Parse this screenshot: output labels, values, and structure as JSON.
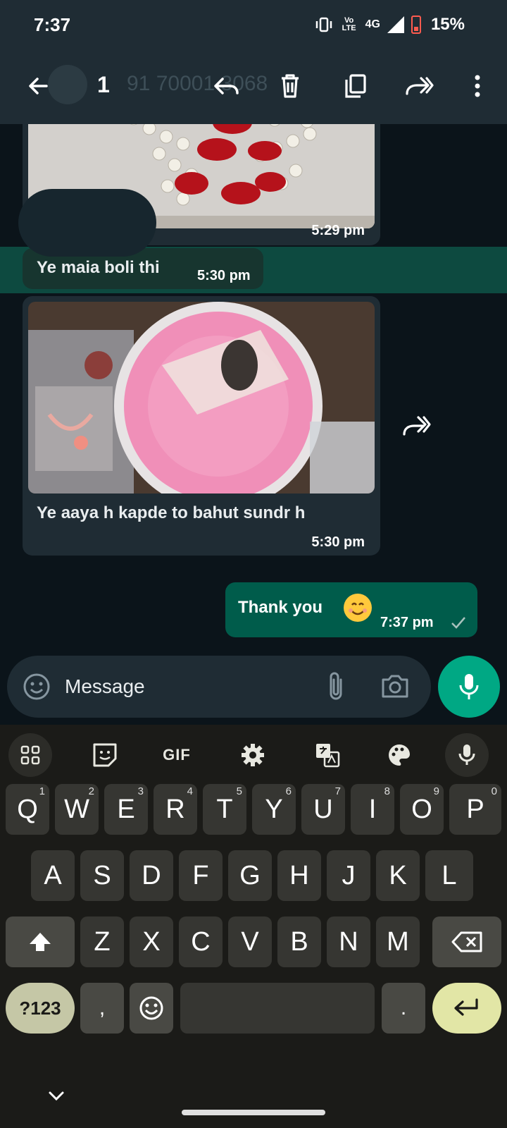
{
  "status_bar": {
    "time": "7:37",
    "network_volte": "Vo LTE",
    "network_type": "4G",
    "battery_percent": "15%",
    "battery_color": "#ff5b4f"
  },
  "app_bar": {
    "selected_count": "1",
    "background_number": "91 70001 3068",
    "icons": [
      "back-arrow-icon",
      "reply-icon",
      "delete-icon",
      "copy-icon",
      "forward-icon",
      "more-vert-icon"
    ]
  },
  "chat": {
    "messages": [
      {
        "type": "image",
        "direction": "incoming",
        "subject": "red and white pearl necklace",
        "time": "5:29 pm"
      },
      {
        "type": "text",
        "direction": "incoming",
        "text": "Ye maia boli thi",
        "time": "5:30 pm",
        "selected": true
      },
      {
        "type": "image",
        "direction": "incoming",
        "subject": "pink dress and jewelry set",
        "caption": "Ye aaya h kapde to bahut sundr h",
        "time": "5:30 pm"
      },
      {
        "type": "text",
        "direction": "outgoing",
        "text": "Thank you",
        "emoji": "smiling-face",
        "time": "7:37 pm",
        "status": "sent-tick"
      }
    ],
    "accent_outgoing": "#005c4b",
    "accent_selection": "#0d4a40"
  },
  "composer": {
    "placeholder": "Message",
    "icons": [
      "emoji-icon",
      "attach-icon",
      "camera-icon",
      "mic-icon"
    ],
    "send_button_color": "#00a884"
  },
  "keyboard": {
    "toolbar": [
      "apps-grid-icon",
      "sticker-icon",
      "GIF",
      "settings-icon",
      "translate-icon",
      "palette-icon",
      "mic-icon"
    ],
    "gif_label": "GIF",
    "row1": [
      {
        "k": "Q",
        "n": "1"
      },
      {
        "k": "W",
        "n": "2"
      },
      {
        "k": "E",
        "n": "3"
      },
      {
        "k": "R",
        "n": "4"
      },
      {
        "k": "T",
        "n": "5"
      },
      {
        "k": "Y",
        "n": "6"
      },
      {
        "k": "U",
        "n": "7"
      },
      {
        "k": "I",
        "n": "8"
      },
      {
        "k": "O",
        "n": "9"
      },
      {
        "k": "P",
        "n": "0"
      }
    ],
    "row2": [
      "A",
      "S",
      "D",
      "F",
      "G",
      "H",
      "J",
      "K",
      "L"
    ],
    "row3": [
      "Z",
      "X",
      "C",
      "V",
      "B",
      "N",
      "M"
    ],
    "symbols_label": "?123",
    "comma": ",",
    "period": "."
  }
}
